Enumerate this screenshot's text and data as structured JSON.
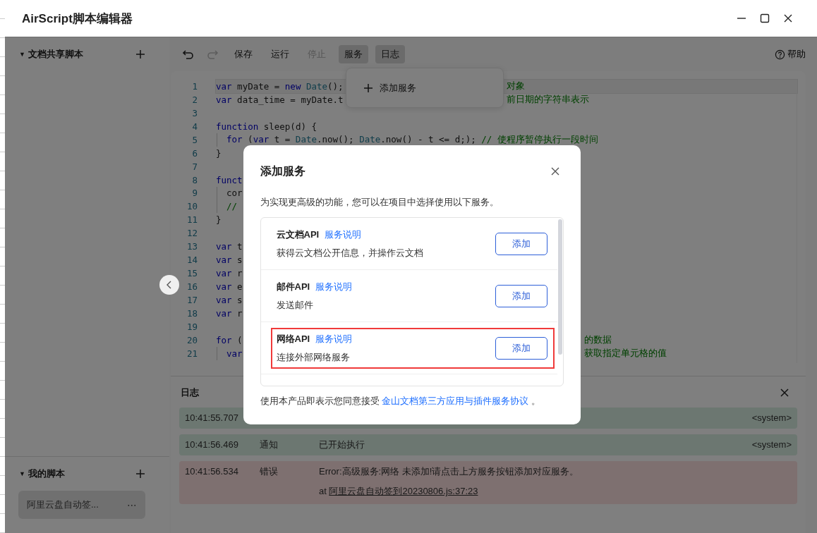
{
  "window": {
    "title": "AirScript脚本编辑器"
  },
  "sidebar": {
    "sections": [
      {
        "title": "文档共享脚本",
        "toggle": "▼"
      },
      {
        "title": "我的脚本",
        "toggle": "▼",
        "items": [
          {
            "label": "阿里云盘自动签...",
            "selected": true,
            "more": "⋯"
          }
        ]
      }
    ]
  },
  "toolbar": {
    "buttons": [
      {
        "kind": "undo",
        "disabled": false
      },
      {
        "kind": "redo",
        "disabled": true
      },
      {
        "kind": "text",
        "label": "保存",
        "disabled": false,
        "active": false
      },
      {
        "kind": "text",
        "label": "运行",
        "disabled": false,
        "active": false
      },
      {
        "kind": "text",
        "label": "停止",
        "disabled": true,
        "active": false
      },
      {
        "kind": "text",
        "label": "服务",
        "disabled": false,
        "active": true
      },
      {
        "kind": "text",
        "label": "日志",
        "disabled": false,
        "active": true
      }
    ],
    "help": "帮助"
  },
  "service_menu": {
    "items": [
      {
        "label": "添加服务"
      }
    ]
  },
  "editor": {
    "lines": [
      {
        "n": "1",
        "active": true,
        "indent": false,
        "tokens": [
          {
            "kind": "kw",
            "text": "var"
          },
          {
            "kind": "plain",
            "text": " myDate = "
          },
          {
            "kind": "kw",
            "text": "new"
          },
          {
            "kind": "cls",
            "text": " Date"
          },
          {
            "kind": "plain",
            "text": "();"
          }
        ],
        "right": "对象"
      },
      {
        "n": "2",
        "active": false,
        "indent": false,
        "tokens": [
          {
            "kind": "kw",
            "text": "var"
          },
          {
            "kind": "plain",
            "text": " data_time = myDate.t"
          }
        ],
        "right": "前日期的字符串表示"
      },
      {
        "n": "3",
        "active": false,
        "indent": false
      },
      {
        "n": "4",
        "active": false,
        "indent": false,
        "tokens": [
          {
            "kind": "kw",
            "text": "function"
          },
          {
            "kind": "plain",
            "text": " sleep(d) {"
          }
        ]
      },
      {
        "n": "5",
        "active": false,
        "indent": true,
        "tokens": [
          {
            "kind": "kw",
            "text": "for"
          },
          {
            "kind": "plain",
            "text": " ("
          },
          {
            "kind": "kw",
            "text": "var"
          },
          {
            "kind": "plain",
            "text": " t = "
          },
          {
            "kind": "cls",
            "text": "Date"
          },
          {
            "kind": "plain",
            "text": ".now(); "
          },
          {
            "kind": "cls",
            "text": "Date"
          },
          {
            "kind": "plain",
            "text": ".now() - t <= d;); "
          },
          {
            "kind": "comment",
            "text": "// 使程序暂停执行一段时间"
          }
        ]
      },
      {
        "n": "6",
        "active": false,
        "indent": false,
        "tokens": [
          {
            "kind": "plain",
            "text": "}"
          }
        ]
      },
      {
        "n": "7",
        "active": false,
        "indent": false
      },
      {
        "n": "8",
        "active": false,
        "indent": false,
        "tokens": [
          {
            "kind": "kw",
            "text": "funct"
          }
        ]
      },
      {
        "n": "9",
        "active": false,
        "indent": true,
        "tokens": [
          {
            "kind": "plain",
            "text": "cor"
          }
        ]
      },
      {
        "n": "10",
        "active": false,
        "indent": true,
        "tokens": [
          {
            "kind": "comment",
            "text": "//"
          }
        ]
      },
      {
        "n": "11",
        "active": false,
        "indent": false,
        "tokens": [
          {
            "kind": "plain",
            "text": "}"
          }
        ]
      },
      {
        "n": "12",
        "active": false,
        "indent": false
      },
      {
        "n": "13",
        "active": false,
        "indent": false,
        "tokens": [
          {
            "kind": "kw",
            "text": "var"
          },
          {
            "kind": "plain",
            "text": " t"
          }
        ]
      },
      {
        "n": "14",
        "active": false,
        "indent": false,
        "tokens": [
          {
            "kind": "kw",
            "text": "var"
          },
          {
            "kind": "plain",
            "text": " s"
          }
        ]
      },
      {
        "n": "15",
        "active": false,
        "indent": false,
        "tokens": [
          {
            "kind": "kw",
            "text": "var"
          },
          {
            "kind": "plain",
            "text": " r"
          }
        ]
      },
      {
        "n": "16",
        "active": false,
        "indent": false,
        "tokens": [
          {
            "kind": "kw",
            "text": "var"
          },
          {
            "kind": "plain",
            "text": " e"
          }
        ]
      },
      {
        "n": "17",
        "active": false,
        "indent": false,
        "tokens": [
          {
            "kind": "kw",
            "text": "var"
          },
          {
            "kind": "plain",
            "text": " s"
          }
        ]
      },
      {
        "n": "18",
        "active": false,
        "indent": false,
        "tokens": [
          {
            "kind": "kw",
            "text": "var"
          },
          {
            "kind": "plain",
            "text": " r"
          }
        ]
      },
      {
        "n": "19",
        "active": false,
        "indent": false
      },
      {
        "n": "20",
        "active": false,
        "indent": false,
        "tokens": [
          {
            "kind": "kw",
            "text": "for"
          },
          {
            "kind": "plain",
            "text": " ("
          }
        ],
        "right": "的数据"
      },
      {
        "n": "21",
        "active": false,
        "indent": true,
        "tokens": [
          {
            "kind": "kw",
            "text": "var"
          }
        ],
        "right": "获取指定单元格的值"
      }
    ]
  },
  "log": {
    "title": "日志",
    "rows": [
      {
        "kind": "info",
        "time": "10:41:55.707",
        "source": "<system>"
      },
      {
        "kind": "info",
        "time": "10:41:56.469",
        "type": "通知",
        "message": "已开始执行",
        "source": "<system>"
      },
      {
        "kind": "error",
        "time": "10:41:56.534",
        "type": "错误",
        "message": "Error:高级服务:网络 未添加!请点击上方服务按钮添加对应服务。",
        "at": "at",
        "location": "阿里云盘自动签到20230806.js:37:23"
      }
    ]
  },
  "dialog": {
    "title": "添加服务",
    "description": "为实现更高级的功能，您可以在项目中选择使用以下服务。",
    "services": [
      {
        "name": "云文档API",
        "link": "服务说明",
        "description": "获得云文档公开信息，并操作云文档",
        "button": "添加",
        "highlighted": false
      },
      {
        "name": "邮件API",
        "link": "服务说明",
        "description": "发送邮件",
        "button": "添加",
        "highlighted": false
      },
      {
        "name": "网络API",
        "link": "服务说明",
        "description": "连接外部网络服务",
        "button": "添加",
        "highlighted": true
      }
    ],
    "footer": {
      "text": "使用本产品即表示您同意接受",
      "link": "金山文档第三方应用与插件服务协议",
      "end": "。"
    }
  }
}
